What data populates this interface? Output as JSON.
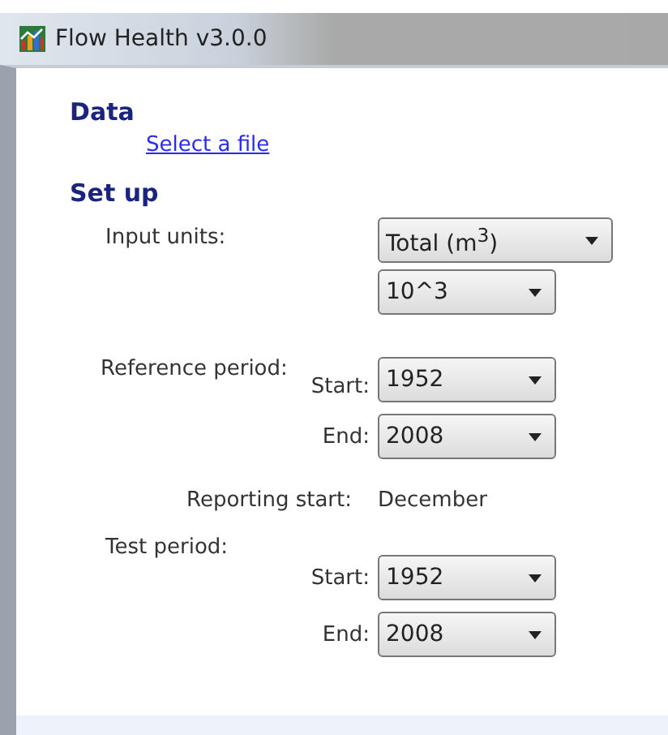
{
  "window": {
    "title": "Flow Health v3.0.0"
  },
  "data": {
    "heading": "Data",
    "link": "Select a file"
  },
  "setup": {
    "heading": "Set up",
    "input_units": {
      "label": "Input units:",
      "unit": "Total (m$^{3}$)",
      "scale": "10^3"
    },
    "reference_period": {
      "label": "Reference period:",
      "start_label": "Start:",
      "start": "1952",
      "end_label": "End:",
      "end": "2008"
    },
    "reporting_start": {
      "label": "Reporting start:",
      "value": "December"
    },
    "test_period": {
      "label": "Test period:",
      "start_label": "Start:",
      "start": "1952",
      "end_label": "End:",
      "end": "2008"
    }
  }
}
